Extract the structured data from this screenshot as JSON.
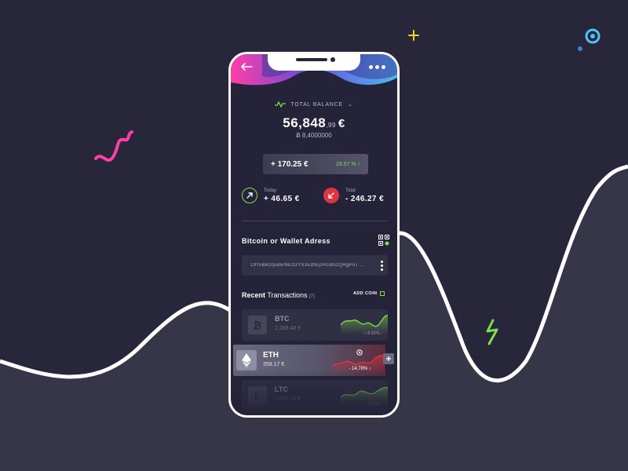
{
  "header": {
    "back_icon": "arrow-left-icon",
    "more_icon": "more-dots-icon"
  },
  "balance": {
    "label": "TOTAL BALANCE",
    "amount_main": "56,848",
    "amount_cents": ",99",
    "currency": "€",
    "btc_amount": "Ƀ 8,4000000"
  },
  "change": {
    "amount": "+ 170.25 €",
    "percent": "19.57 %",
    "arrow": "↑"
  },
  "stats": {
    "today_label": "Today",
    "today_value": "+ 46.65 €",
    "total_label": "Total",
    "total_value": "- 246.27 €"
  },
  "wallet": {
    "title": "Bitcoin or Wallet Adress",
    "address": "19YvBkUrpa5P6Et1rYS3vJhEjsRGBszQRgPoT ..."
  },
  "transactions": {
    "title_bold": "Recent",
    "title_rest": " Transactions",
    "count": "(7)",
    "add_coin_label": "ADD COIN",
    "coins": [
      {
        "symbol": "BTC",
        "price": "2,268.48 €",
        "change": "+ 8.56% ↑"
      },
      {
        "symbol": "ETH",
        "price": "358.17 €",
        "change": "- 14.78% ↓"
      },
      {
        "symbol": "LTC",
        "price": "1,058.16 €",
        "change": "+ 4.21% ↑"
      }
    ],
    "plus_label": "+"
  },
  "colors": {
    "background": "#27263a",
    "accent_green": "#7ee04a",
    "accent_red": "#e0353f",
    "accent_pink": "#ff3fa7",
    "accent_blue": "#4fc3f7",
    "accent_yellow": "#f5d020"
  }
}
